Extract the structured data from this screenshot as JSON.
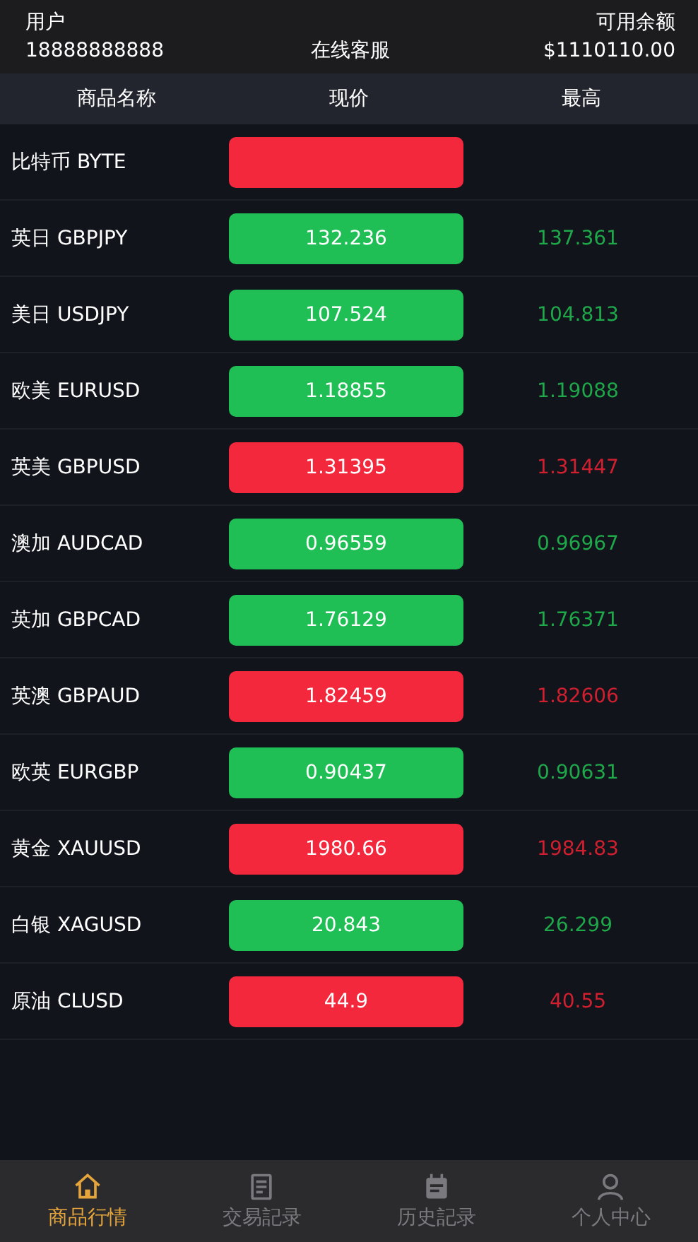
{
  "header": {
    "user_label": "用户",
    "user_phone": "18888888888",
    "service": "在线客服",
    "balance_label": "可用余额",
    "balance": "$1110110.00"
  },
  "columns": [
    "商品名称",
    "现价",
    "最高"
  ],
  "rows": [
    {
      "name": "比特币 BYTE",
      "rising": false
    },
    {
      "name": "英日 GBPJPY",
      "price": "132.236",
      "high": "137.361",
      "rising": true
    },
    {
      "name": "美日 USDJPY",
      "price": "107.524",
      "high": "104.813",
      "rising": true
    },
    {
      "name": "欧美 EURUSD",
      "price": "1.18855",
      "high": "1.19088",
      "rising": true
    },
    {
      "name": "英美 GBPUSD",
      "price": "1.31395",
      "high": "1.31447",
      "rising": false
    },
    {
      "name": "澳加 AUDCAD",
      "price": "0.96559",
      "high": "0.96967",
      "rising": true
    },
    {
      "name": "英加 GBPCAD",
      "price": "1.76129",
      "high": "1.76371",
      "rising": true
    },
    {
      "name": "英澳 GBPAUD",
      "price": "1.82459",
      "high": "1.82606",
      "rising": false
    },
    {
      "name": "欧英 EURGBP",
      "price": "0.90437",
      "high": "0.90631",
      "rising": true
    },
    {
      "name": "黄金 XAUUSD",
      "price": "1980.66",
      "high": "1984.83",
      "rising": false
    },
    {
      "name": "白银 XAGUSD",
      "price": "20.843",
      "high": "26.299",
      "rising": true
    },
    {
      "name": "原油 CLUSD",
      "price": "44.9",
      "high": "40.55",
      "rising": false
    }
  ],
  "nav": [
    {
      "label": "商品行情",
      "kind": "home",
      "selected": true
    },
    {
      "label": "交易記录",
      "kind": "doc",
      "selected": false
    },
    {
      "label": "历史記录",
      "kind": "calendar",
      "selected": false
    },
    {
      "label": "个人中心",
      "kind": "person",
      "selected": false
    }
  ]
}
